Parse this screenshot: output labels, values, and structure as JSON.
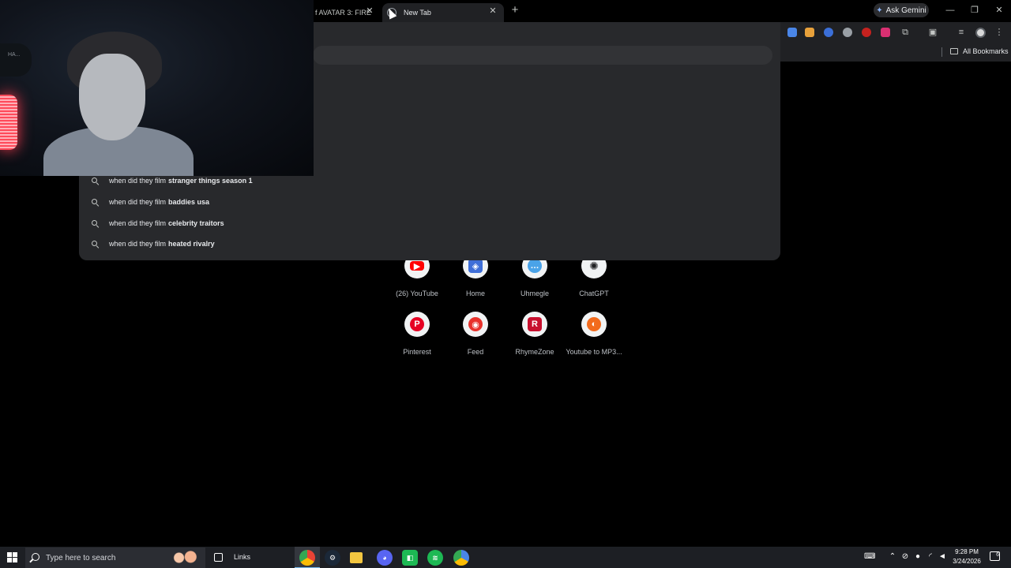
{
  "browser": {
    "tabs": [
      {
        "title": "f AVATAR 3: FIRE",
        "active": false
      },
      {
        "title": "New Tab",
        "active": true
      }
    ],
    "gemini_button": "Ask Gemini",
    "bookmarks_label": "All Bookmarks"
  },
  "omnibox": {
    "suggestions": [
      {
        "prefix": "when did they film",
        "completion": "stranger things season 1"
      },
      {
        "prefix": "when did they film",
        "completion": "baddies usa"
      },
      {
        "prefix": "when did they film",
        "completion": "celebrity traitors"
      },
      {
        "prefix": "when did they film",
        "completion": "heated rivalry"
      }
    ]
  },
  "shortcuts": [
    {
      "label": "(26) YouTube",
      "icon": "youtube-icon",
      "color": "#ff0000"
    },
    {
      "label": "Home",
      "icon": "roblox-icon",
      "color": "#3f6fd8"
    },
    {
      "label": "Uhmegle",
      "icon": "chat-bubble-icon",
      "color": "#4aa3e8"
    },
    {
      "label": "ChatGPT",
      "icon": "openai-icon",
      "color": "#202123"
    },
    {
      "label": "Pinterest",
      "icon": "pinterest-icon",
      "color": "#e60023"
    },
    {
      "label": "Feed",
      "icon": "feed-icon",
      "color": "#e8322c"
    },
    {
      "label": "RhymeZone",
      "icon": "rhymezone-icon",
      "color": "#c8102e"
    },
    {
      "label": "Youtube to MP3...",
      "icon": "converter-icon",
      "color": "#f26b1d"
    }
  ],
  "webcam": {
    "headset_text": "HA..."
  },
  "taskbar": {
    "search_placeholder": "Type here to search",
    "links_label": "Links",
    "apps": [
      "chrome-icon",
      "steam-icon",
      "discord-icon",
      "app-icon",
      "spotify-icon",
      "chrome-alt-icon"
    ],
    "time": "9:28 PM",
    "date": "3/24/2026",
    "notifications": "6"
  }
}
